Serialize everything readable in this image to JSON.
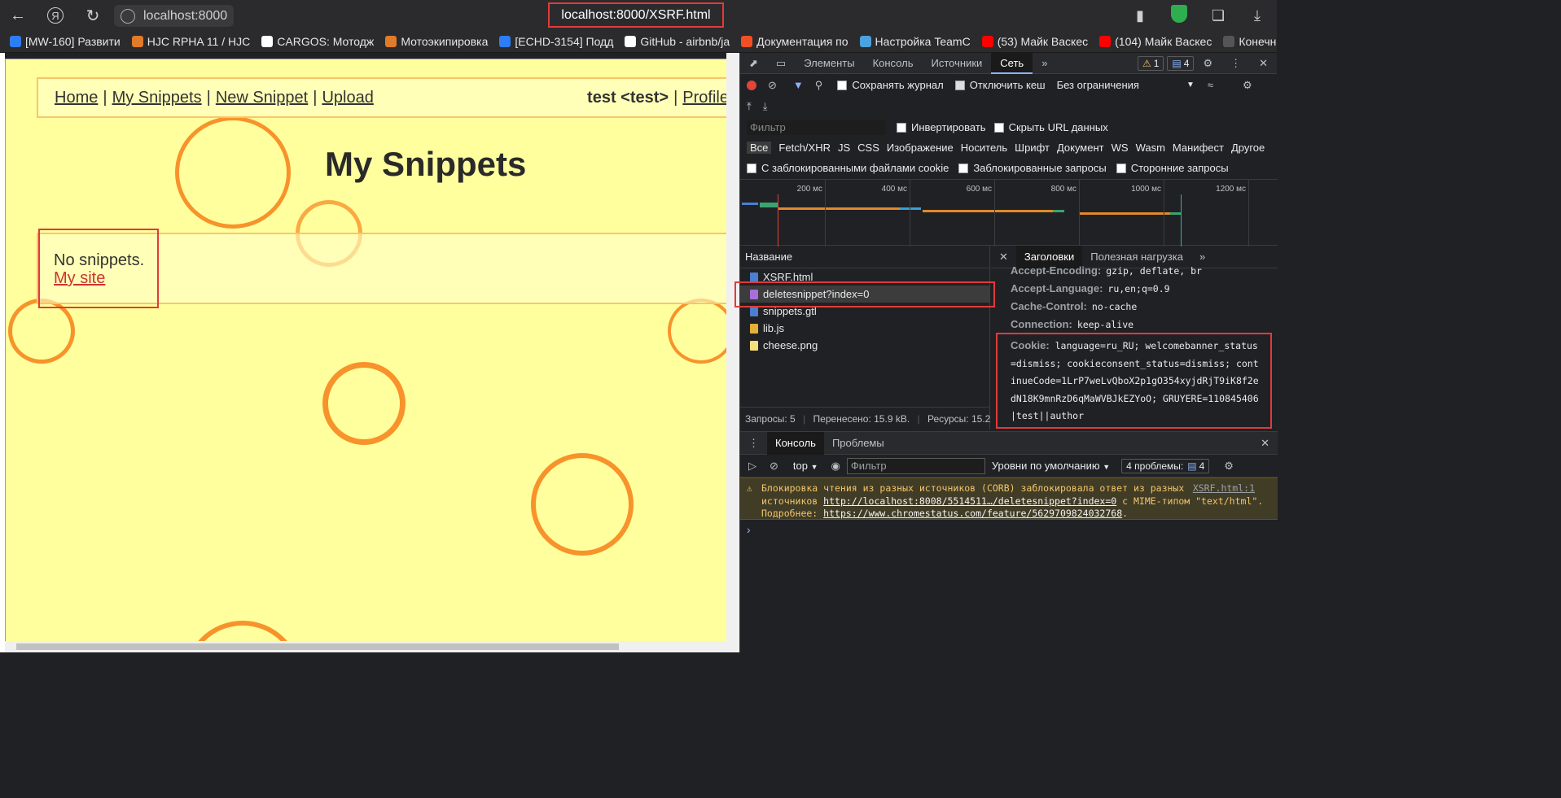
{
  "browser": {
    "site_chip": "localhost:8000",
    "url": "localhost:8000/XSRF.html"
  },
  "bookmarks": [
    {
      "label": "[MW-160] Развити",
      "color": "#2d7df6"
    },
    {
      "label": "HJC RPHA 11 / HJC",
      "color": "#e07b2a"
    },
    {
      "label": "CARGOS: Мотодж",
      "color": "#ffffff"
    },
    {
      "label": "Мотоэкипировка",
      "color": "#e07b2a"
    },
    {
      "label": "[ECHD-3154] Подд",
      "color": "#2d7df6"
    },
    {
      "label": "GitHub - airbnb/ja",
      "color": "#ffffff"
    },
    {
      "label": "Документация по",
      "color": "#f25022"
    },
    {
      "label": "Настройка TeamC",
      "color": "#4aa3df"
    },
    {
      "label": "(53) Майк Васкес",
      "color": "#ff0000"
    },
    {
      "label": "(104) Майк Васкес",
      "color": "#ff0000"
    },
    {
      "label": "Конечное",
      "color": "#555555"
    }
  ],
  "page": {
    "nav": {
      "home": "Home",
      "my_snippets": "My Snippets",
      "new_snippet": "New Snippet",
      "upload": "Upload",
      "sep": "|"
    },
    "user": {
      "name": "test <test>",
      "profile": "Profile"
    },
    "heading": "My Snippets",
    "no_snippets": "No snippets.",
    "my_site": "My site"
  },
  "devtools": {
    "tabs": [
      "Элементы",
      "Консоль",
      "Источники",
      "Сеть"
    ],
    "warn_count": "1",
    "msg_count": "4",
    "toolbar": {
      "preserve_log": "Сохранять журнал",
      "disable_cache": "Отключить кеш",
      "throttle": "Без ограничения"
    },
    "filter_placeholder": "Фильтр",
    "invert": "Инвертировать",
    "hide_urls": "Скрыть URL данных",
    "types": [
      "Все",
      "Fetch/XHR",
      "JS",
      "CSS",
      "Изображение",
      "Носитель",
      "Шрифт",
      "Документ",
      "WS",
      "Wasm",
      "Манифест",
      "Другое"
    ],
    "blocked_cookies": "С заблокированными файлами cookie",
    "blocked_requests": "Заблокированные запросы",
    "third_party": "Сторонние запросы",
    "timeline_ticks": [
      "200 мс",
      "400 мс",
      "600 мс",
      "800 мс",
      "1000 мс",
      "1200 мс"
    ],
    "name_header": "Название",
    "requests": [
      {
        "name": "XSRF.html",
        "color": "#4a7fd1"
      },
      {
        "name": "deletesnippet?index=0",
        "color": "#a96fd8"
      },
      {
        "name": "snippets.gtl",
        "color": "#4a7fd1"
      },
      {
        "name": "lib.js",
        "color": "#e5b03a"
      },
      {
        "name": "cheese.png",
        "color": "#f5e07a"
      }
    ],
    "footer": {
      "requests": "Запросы: 5",
      "transferred": "Перенесено: 15.9 kB.",
      "resources": "Ресурсы: 15.2"
    },
    "detail_tabs": [
      "Заголовки",
      "Полезная нагрузка"
    ],
    "headers": [
      {
        "k": "Accept-Encoding:",
        "v": "gzip, deflate, br"
      },
      {
        "k": "Accept-Language:",
        "v": "ru,en;q=0.9"
      },
      {
        "k": "Cache-Control:",
        "v": "no-cache"
      },
      {
        "k": "Connection:",
        "v": "keep-alive"
      }
    ],
    "cookie_key": "Cookie:",
    "cookie_value": "language=ru_RU; welcomebanner_status=dismiss; cookieconsent_status=dismiss; continueCode=1LrP7weLvQboX2p1gO354xyjdRjT9iK8f2edN18K9mnRzD6qMaWVBJkEZYoO; GRUYERE=110845406|test||author",
    "console_tabs": [
      "Консоль",
      "Проблемы"
    ],
    "console": {
      "context": "top",
      "filter_placeholder": "Фильтр",
      "levels": "Уровни по умолчанию",
      "issues": "4 проблемы:",
      "issues_count": "4",
      "warn_text1": "Блокировка чтения из разных источников (CORB) заблокировала ответ из разных",
      "warn_text2a": "источников ",
      "warn_link1": "http://localhost:8008/5514511…/deletesnippet?index=0",
      "warn_text2b": " с MIME-типом \"text/html\".",
      "warn_text3a": "Подробнее: ",
      "warn_link2": "https://www.chromestatus.com/feature/5629709824032768",
      "warn_text3b": ".",
      "warn_source": "XSRF.html:1"
    }
  }
}
